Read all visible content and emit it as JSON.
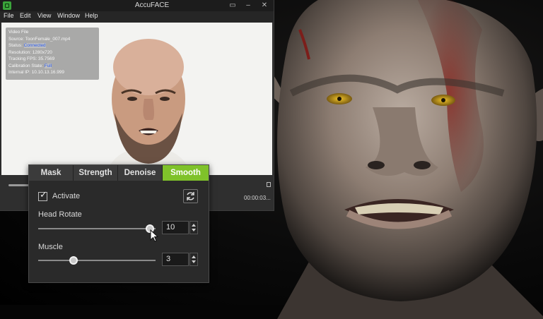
{
  "app": {
    "title": "AccuFACE",
    "menu": [
      "File",
      "Edit",
      "View",
      "Window",
      "Help"
    ]
  },
  "video_info": {
    "lines": [
      {
        "label": "Video File",
        "value": ""
      },
      {
        "label": "Source: ",
        "value": "ToonFemale_007.mp4"
      },
      {
        "label": "Status: ",
        "value": "Connected"
      },
      {
        "label": "Resolution: ",
        "value": "1280x720"
      },
      {
        "label": "Tracking FPS: ",
        "value": "35.7569"
      },
      {
        "label": "Calibration State: ",
        "value": "Full"
      },
      {
        "label": "Internal IP: ",
        "value": "10.10.13.16.999"
      }
    ]
  },
  "playback": {
    "time": "00:00:03..."
  },
  "panel": {
    "tabs": [
      "Mask",
      "Strength",
      "Denoise",
      "Smooth"
    ],
    "active_tab": "Smooth",
    "activate_label": "Activate",
    "activate_checked": true,
    "sliders": [
      {
        "label": "Head Rotate",
        "value": "10",
        "fraction": 0.95
      },
      {
        "label": "Muscle",
        "value": "3",
        "fraction": 0.3
      }
    ]
  },
  "colors": {
    "accent": "#7fc22a",
    "status_connected": "#2f5ff0"
  },
  "icons": [
    "app-logo-icon",
    "minimize-icon",
    "maximize-icon",
    "close-icon",
    "refresh-icon",
    "mouse-cursor-icon"
  ]
}
